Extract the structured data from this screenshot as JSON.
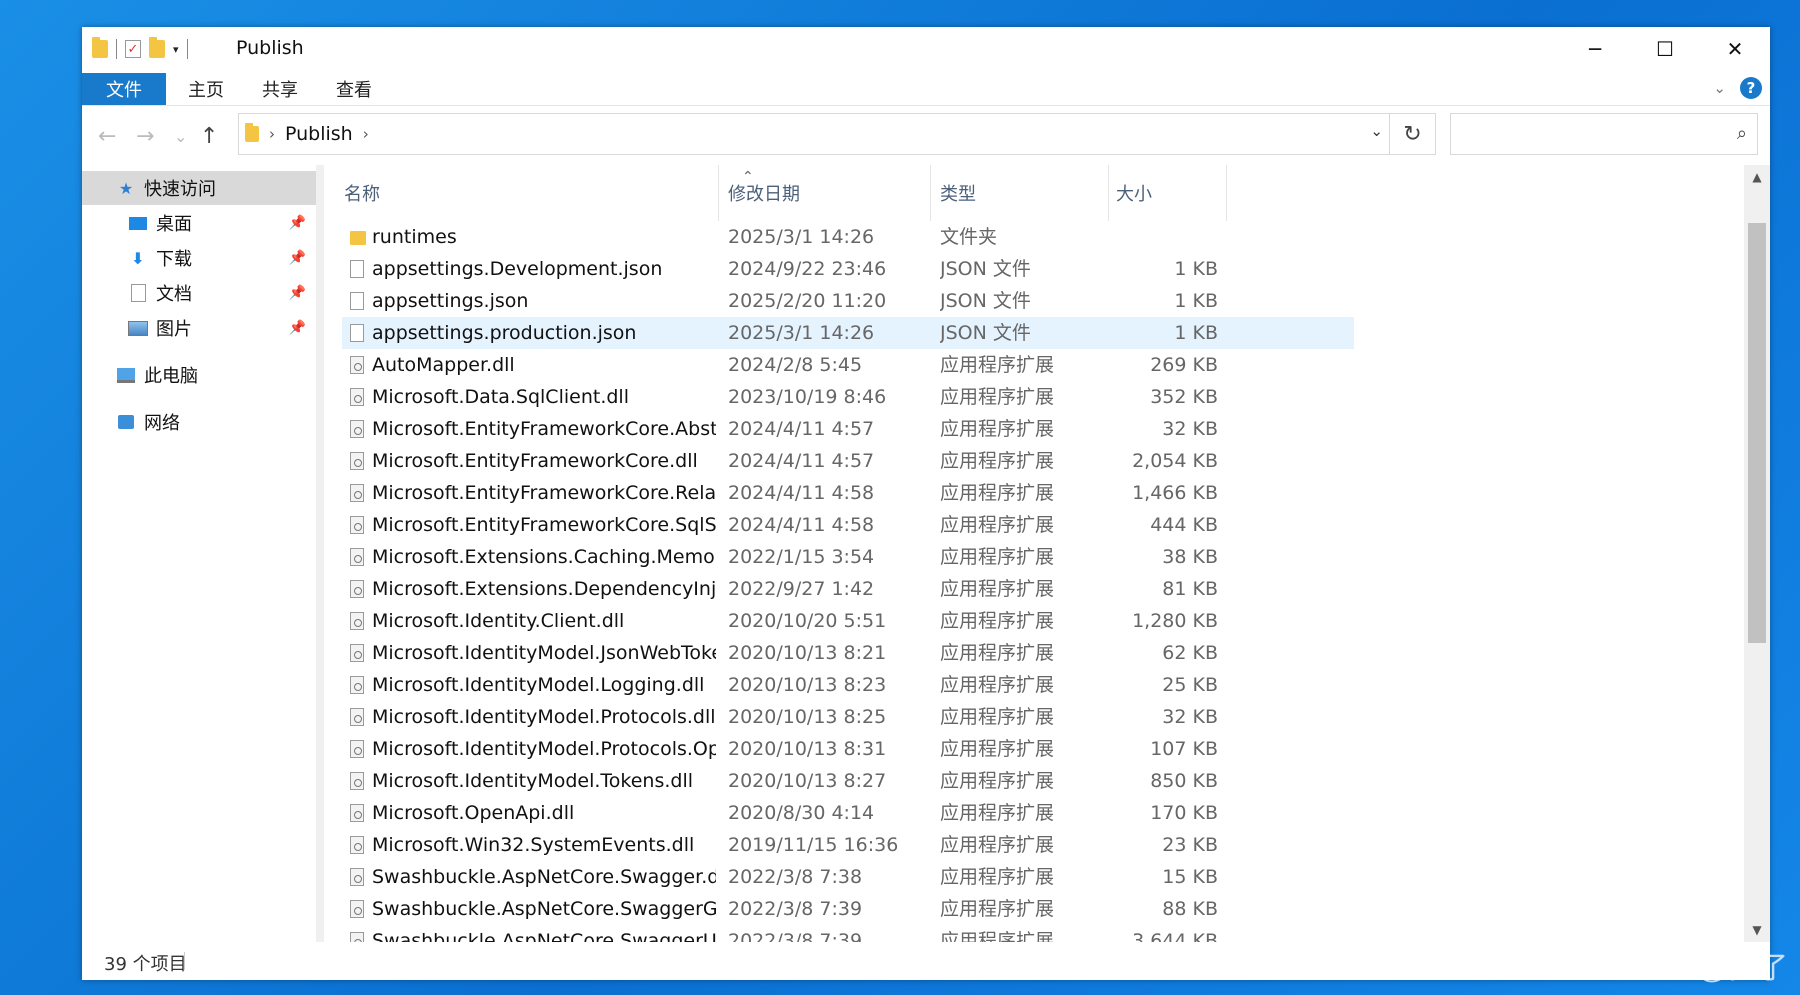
{
  "window": {
    "title": "Publish",
    "controls": {
      "minimize": "─",
      "maximize": "☐",
      "close": "✕"
    }
  },
  "ribbon": {
    "tabs": [
      {
        "label": "文件"
      },
      {
        "label": "主页"
      },
      {
        "label": "共享"
      },
      {
        "label": "查看"
      }
    ]
  },
  "nav": {
    "back": "←",
    "forward": "→",
    "recent": "⌄",
    "up": "↑",
    "breadcrumb": "Publish",
    "refresh": "↻",
    "search_placeholder": ""
  },
  "sidebar": {
    "items": [
      {
        "label": "快速访问",
        "icon": "star-icon",
        "pinned": false,
        "selected": true
      },
      {
        "label": "桌面",
        "icon": "desktop-icon",
        "pinned": true,
        "selected": false
      },
      {
        "label": "下载",
        "icon": "download-icon",
        "pinned": true,
        "selected": false
      },
      {
        "label": "文档",
        "icon": "documents-icon",
        "pinned": true,
        "selected": false
      },
      {
        "label": "图片",
        "icon": "pictures-icon",
        "pinned": true,
        "selected": false
      },
      {
        "label": "此电脑",
        "icon": "computer-icon",
        "pinned": false,
        "selected": false
      },
      {
        "label": "网络",
        "icon": "network-icon",
        "pinned": false,
        "selected": false
      }
    ]
  },
  "columns": {
    "name": "名称",
    "date": "修改日期",
    "type": "类型",
    "size": "大小"
  },
  "files": [
    {
      "name": "runtimes",
      "date": "2025/3/1 14:26",
      "type": "文件夹",
      "size": "",
      "kind": "folder"
    },
    {
      "name": "appsettings.Development.json",
      "date": "2024/9/22 23:46",
      "type": "JSON 文件",
      "size": "1 KB",
      "kind": "json"
    },
    {
      "name": "appsettings.json",
      "date": "2025/2/20 11:20",
      "type": "JSON 文件",
      "size": "1 KB",
      "kind": "json"
    },
    {
      "name": "appsettings.production.json",
      "date": "2025/3/1 14:26",
      "type": "JSON 文件",
      "size": "1 KB",
      "kind": "json",
      "highlight": true
    },
    {
      "name": "AutoMapper.dll",
      "date": "2024/2/8 5:45",
      "type": "应用程序扩展",
      "size": "269 KB",
      "kind": "dll"
    },
    {
      "name": "Microsoft.Data.SqlClient.dll",
      "date": "2023/10/19 8:46",
      "type": "应用程序扩展",
      "size": "352 KB",
      "kind": "dll"
    },
    {
      "name": "Microsoft.EntityFrameworkCore.Abstraction...",
      "date": "2024/4/11 4:57",
      "type": "应用程序扩展",
      "size": "32 KB",
      "kind": "dll"
    },
    {
      "name": "Microsoft.EntityFrameworkCore.dll",
      "date": "2024/4/11 4:57",
      "type": "应用程序扩展",
      "size": "2,054 KB",
      "kind": "dll"
    },
    {
      "name": "Microsoft.EntityFrameworkCore.Relational.dll",
      "date": "2024/4/11 4:58",
      "type": "应用程序扩展",
      "size": "1,466 KB",
      "kind": "dll"
    },
    {
      "name": "Microsoft.EntityFrameworkCore.SqlServer.dll",
      "date": "2024/4/11 4:58",
      "type": "应用程序扩展",
      "size": "444 KB",
      "kind": "dll"
    },
    {
      "name": "Microsoft.Extensions.Caching.Memory.dll",
      "date": "2022/1/15 3:54",
      "type": "应用程序扩展",
      "size": "38 KB",
      "kind": "dll"
    },
    {
      "name": "Microsoft.Extensions.DependencyInjection.dll",
      "date": "2022/9/27 1:42",
      "type": "应用程序扩展",
      "size": "81 KB",
      "kind": "dll"
    },
    {
      "name": "Microsoft.Identity.Client.dll",
      "date": "2020/10/20 5:51",
      "type": "应用程序扩展",
      "size": "1,280 KB",
      "kind": "dll"
    },
    {
      "name": "Microsoft.IdentityModel.JsonWebTokens.dll",
      "date": "2020/10/13 8:21",
      "type": "应用程序扩展",
      "size": "62 KB",
      "kind": "dll"
    },
    {
      "name": "Microsoft.IdentityModel.Logging.dll",
      "date": "2020/10/13 8:23",
      "type": "应用程序扩展",
      "size": "25 KB",
      "kind": "dll"
    },
    {
      "name": "Microsoft.IdentityModel.Protocols.dll",
      "date": "2020/10/13 8:25",
      "type": "应用程序扩展",
      "size": "32 KB",
      "kind": "dll"
    },
    {
      "name": "Microsoft.IdentityModel.Protocols.OpenIdC...",
      "date": "2020/10/13 8:31",
      "type": "应用程序扩展",
      "size": "107 KB",
      "kind": "dll"
    },
    {
      "name": "Microsoft.IdentityModel.Tokens.dll",
      "date": "2020/10/13 8:27",
      "type": "应用程序扩展",
      "size": "850 KB",
      "kind": "dll"
    },
    {
      "name": "Microsoft.OpenApi.dll",
      "date": "2020/8/30 4:14",
      "type": "应用程序扩展",
      "size": "170 KB",
      "kind": "dll"
    },
    {
      "name": "Microsoft.Win32.SystemEvents.dll",
      "date": "2019/11/15 16:36",
      "type": "应用程序扩展",
      "size": "23 KB",
      "kind": "dll"
    },
    {
      "name": "Swashbuckle.AspNetCore.Swagger.dll",
      "date": "2022/3/8 7:38",
      "type": "应用程序扩展",
      "size": "15 KB",
      "kind": "dll"
    },
    {
      "name": "Swashbuckle.AspNetCore.SwaggerGen.dll",
      "date": "2022/3/8 7:39",
      "type": "应用程序扩展",
      "size": "88 KB",
      "kind": "dll"
    },
    {
      "name": "Swashbuckle.AspNetCore.SwaggerUI.dll",
      "date": "2022/3/8 7:39",
      "type": "应用程序扩展",
      "size": "3,644 KB",
      "kind": "dll"
    }
  ],
  "status": {
    "count": "39 个项目"
  },
  "watermark": "CSDN @梦了",
  "colors": {
    "accent": "#1979ca",
    "highlight_row": "#e5f3ff",
    "folder": "#f4c542"
  }
}
